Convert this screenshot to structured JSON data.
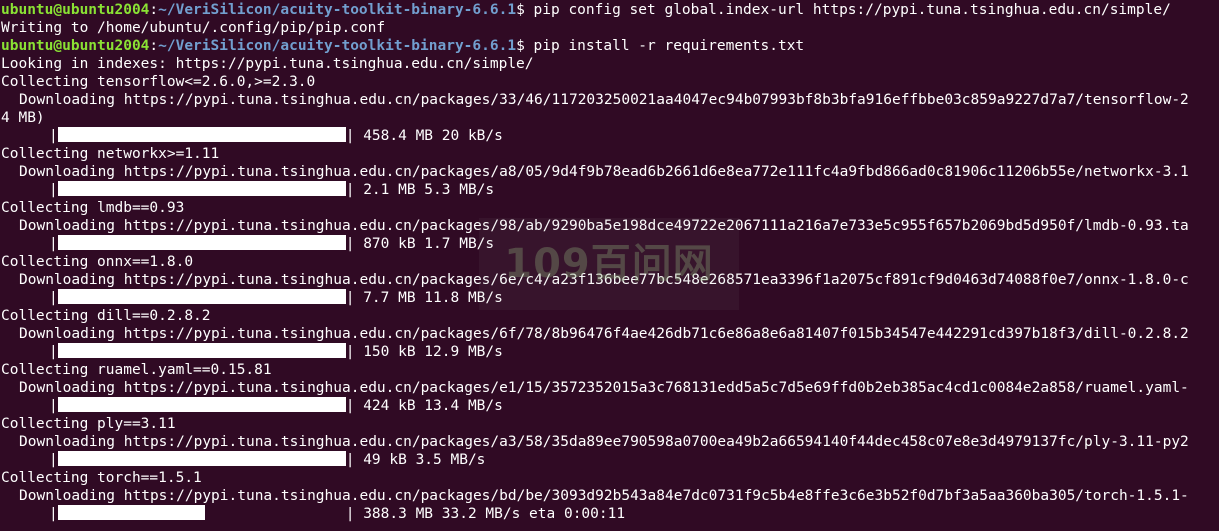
{
  "prompt": {
    "userhost": "ubuntu@ubuntu2004",
    "sep": ":",
    "path": "~/VeriSilicon/acuity-toolkit-binary-6.6.1",
    "symbol": "$ "
  },
  "commands": {
    "pip_config": "pip config set global.index-url https://pypi.tuna.tsinghua.edu.cn/simple/",
    "pip_install": "pip install -r requirements.txt"
  },
  "output": {
    "writing": "Writing to /home/ubuntu/.config/pip/pip.conf",
    "looking": "Looking in indexes: https://pypi.tuna.tsinghua.edu.cn/simple/"
  },
  "packages": [
    {
      "collecting": "Collecting tensorflow<=2.6.0,>=2.3.0",
      "downloading": "Downloading https://pypi.tuna.tsinghua.edu.cn/packages/33/46/117203250021aa4047ec94b07993bf8b3bfa916effbbe03c859a9227d7a7/tensorflow-2",
      "wrap": "4 MB)",
      "stats": "| 458.4 MB 20 kB/s",
      "progress": 1.0
    },
    {
      "collecting": "Collecting networkx>=1.11",
      "downloading": "Downloading https://pypi.tuna.tsinghua.edu.cn/packages/a8/05/9d4f9b78ead6b2661d6e8ea772e111fc4a9fbd866ad0c81906c11206b55e/networkx-3.1",
      "stats": "| 2.1 MB 5.3 MB/s",
      "progress": 1.0
    },
    {
      "collecting": "Collecting lmdb==0.93",
      "downloading": "Downloading https://pypi.tuna.tsinghua.edu.cn/packages/98/ab/9290ba5e198dce49722e2067111a216a7e733e5c955f657b2069bd5d950f/lmdb-0.93.ta",
      "stats": "| 870 kB 1.7 MB/s",
      "progress": 1.0
    },
    {
      "collecting": "Collecting onnx==1.8.0",
      "downloading": "Downloading https://pypi.tuna.tsinghua.edu.cn/packages/6e/c4/a23f136bee77bc548e268571ea3396f1a2075cf891cf9d0463d74088f0e7/onnx-1.8.0-c",
      "stats": "| 7.7 MB 11.8 MB/s",
      "progress": 1.0
    },
    {
      "collecting": "Collecting dill==0.2.8.2",
      "downloading": "Downloading https://pypi.tuna.tsinghua.edu.cn/packages/6f/78/8b96476f4ae426db71c6e86a8e6a81407f015b34547e442291cd397b18f3/dill-0.2.8.2",
      "stats": "| 150 kB 12.9 MB/s",
      "progress": 1.0
    },
    {
      "collecting": "Collecting ruamel.yaml==0.15.81",
      "downloading": "Downloading https://pypi.tuna.tsinghua.edu.cn/packages/e1/15/3572352015a3c768131edd5a5c7d5e69ffd0b2eb385ac4cd1c0084e2a858/ruamel.yaml-",
      "stats": "| 424 kB 13.4 MB/s",
      "progress": 1.0
    },
    {
      "collecting": "Collecting ply==3.11",
      "downloading": "Downloading https://pypi.tuna.tsinghua.edu.cn/packages/a3/58/35da89ee790598a0700ea49b2a66594140f44dec458c07e8e3d4979137fc/ply-3.11-py2",
      "stats": "| 49 kB 3.5 MB/s",
      "progress": 1.0
    },
    {
      "collecting": "Collecting torch==1.5.1",
      "downloading": "Downloading https://pypi.tuna.tsinghua.edu.cn/packages/bd/be/3093d92b543a84e7dc0731f9c5b4e8ffe3c6e3b52f0d7bf3a5aa360ba305/torch-1.5.1-",
      "stats": "| 388.3 MB 33.2 MB/s eta 0:00:11",
      "progress": 0.51
    }
  ],
  "bar_prefix": "|",
  "watermark": "109百问网",
  "colors": {
    "background": "#300a24",
    "prompt_user": "#8ae234",
    "prompt_path": "#729fcf",
    "text": "#ffffff",
    "progress_fill": "#ffffff"
  }
}
